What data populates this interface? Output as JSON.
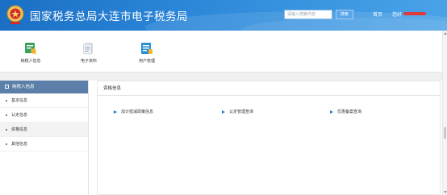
{
  "header": {
    "title": "国家税务总局大连市电子税务局",
    "search_placeholder": "请输入搜索内容",
    "search_button": "搜索",
    "home_link": "首页",
    "user_link": "您好"
  },
  "topnav": {
    "tiles": [
      {
        "label": "纳税人信息",
        "icon": "taxpayer-info-icon"
      },
      {
        "label": "电子资料",
        "icon": "electronic-documents-icon"
      },
      {
        "label": "用户管理",
        "icon": "user-management-icon"
      }
    ]
  },
  "sidebar": {
    "header": "纳税人信息",
    "items": [
      {
        "label": "基本信息"
      },
      {
        "label": "认定信息"
      },
      {
        "label": "资格信息"
      },
      {
        "label": "其他信息"
      }
    ]
  },
  "main": {
    "title": "资格信息",
    "links": [
      {
        "label": "加计抵减政策信息"
      },
      {
        "label": "认定管理查询"
      },
      {
        "label": "优惠备案查询"
      }
    ]
  },
  "colors": {
    "header_start": "#1a6fc4",
    "header_end": "#4aa3e8",
    "sidebar_header": "#5b7fa8",
    "link_arrow": "#2b6fc4"
  }
}
